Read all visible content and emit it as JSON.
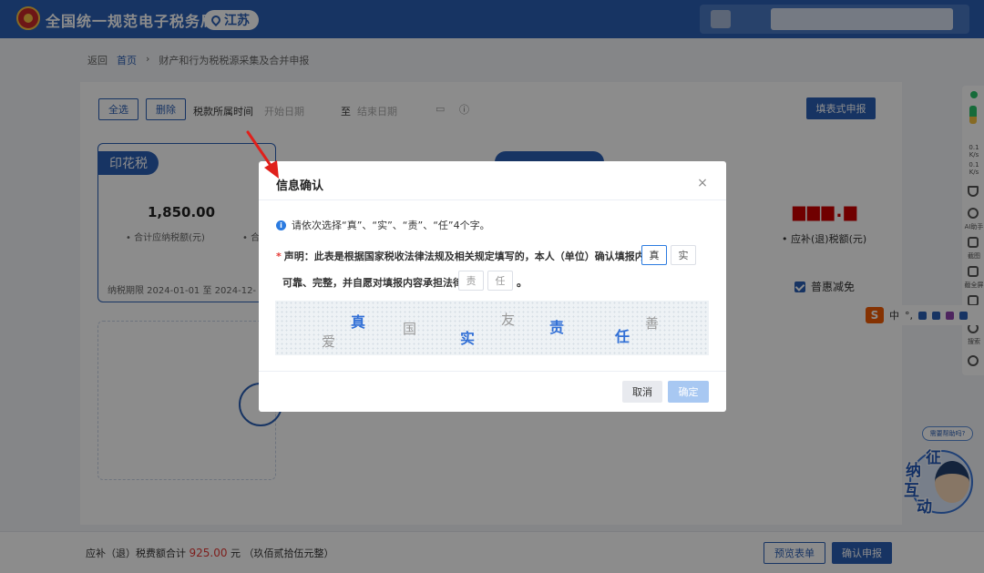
{
  "header": {
    "site_title": "全国统一规范电子税务局",
    "region": "江苏"
  },
  "breadcrumb": {
    "back": "返回",
    "home": "首页",
    "separator": "›",
    "current": "财产和行为税税源采集及合并申报"
  },
  "toolbar": {
    "select_all": "全选",
    "delete": "删除",
    "period_label": "税款所属时间",
    "start_placeholder": "开始日期",
    "to": "至",
    "end_placeholder": "结束日期",
    "form_filing": "填表式申报"
  },
  "card_stamp": {
    "tag": "印花税",
    "amount": "1,850.00",
    "amount_label": "合计应纳税额(元)",
    "amount_label_2": "合",
    "period": "纳税期限 2024-01-01 至 2024-12-"
  },
  "card_right": {
    "amount_label": "应补(退)税额(元)",
    "benefit_checkbox": "普惠减免"
  },
  "footer": {
    "total_label": "应补（退）税费额合计",
    "total_amount": "925.00",
    "unit": "元",
    "amount_words": "（玖佰贰拾伍元整）",
    "preview": "预览表单",
    "submit": "确认申报"
  },
  "side_toolbar": {
    "net_up": "0.1",
    "net_up_unit": "K/s",
    "net_down": "0.1",
    "net_down_unit": "K/s",
    "ai": "AI助手",
    "screenshot": "截图",
    "fullscreen": "截全屏",
    "search": "搜索"
  },
  "ime": {
    "logo": "S",
    "lang": "中",
    "punct": "°,"
  },
  "help": {
    "bubble": "需要帮助吗?",
    "c1": "征",
    "c2": "纳",
    "c3": "互",
    "c4": "动"
  },
  "modal": {
    "title": "信息确认",
    "close": "×",
    "instruction": "请依次选择“真”、“实”、“责”、“任”4个字。",
    "required_mark": "*",
    "decl_line1": "声明：此表是根据国家税收法律法规及相关规定填写的，本人（单位）确认填报内容",
    "decl_line2": "可靠、完整，并自愿对填报内容承担法律",
    "decl_end": "。",
    "slots": [
      "真",
      "实",
      "责",
      "任"
    ],
    "captcha_chars": [
      "爱",
      "真",
      "国",
      "实",
      "友",
      "责",
      "任",
      "善"
    ],
    "cancel": "取消",
    "confirm": "确定"
  }
}
